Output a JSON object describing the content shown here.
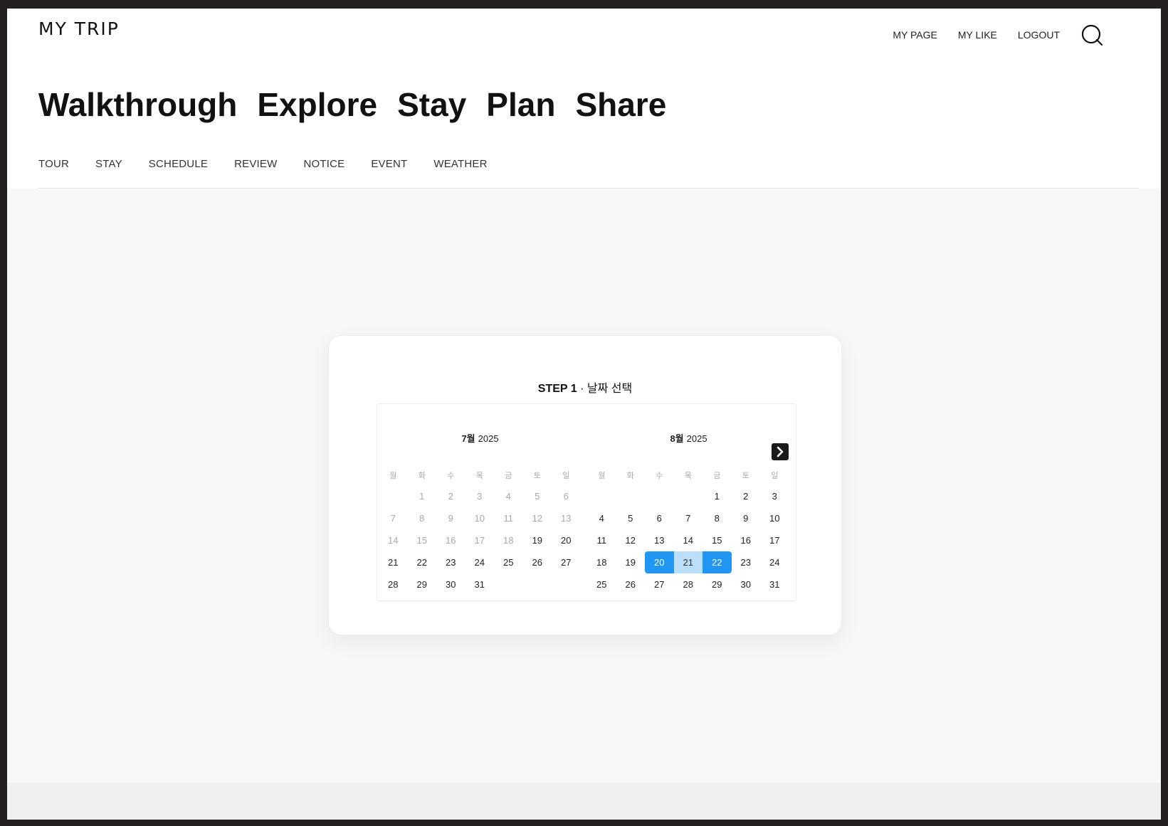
{
  "header": {
    "logo": "MY TRIP",
    "util_nav": [
      "MY PAGE",
      "MY LIKE",
      "LOGOUT"
    ],
    "search_icon": "search-icon"
  },
  "main_nav": [
    "Walkthrough",
    "Explore",
    "Stay",
    "Plan",
    "Share"
  ],
  "sub_nav": [
    "TOUR",
    "STAY",
    "SCHEDULE",
    "REVIEW",
    "NOTICE",
    "EVENT",
    "WEATHER"
  ],
  "step": {
    "label": "STEP 1",
    "separator": " · ",
    "title": "날짜 선택"
  },
  "calendar": {
    "next_icon": "chevron-right-icon",
    "weekdays": [
      "월",
      "화",
      "수",
      "목",
      "금",
      "토",
      "일"
    ],
    "selection": {
      "start": "2025-08-20",
      "end": "2025-08-22"
    },
    "colors": {
      "selected": "#2196f3",
      "in_range": "#bbdefb"
    },
    "months": [
      {
        "name": "7월",
        "year": "2025",
        "leading_blanks": 1,
        "days": 31,
        "disabled_through": 18
      },
      {
        "name": "8월",
        "year": "2025",
        "leading_blanks": 4,
        "days": 31,
        "disabled_through": 0,
        "selected_start": 20,
        "selected_end": 22
      }
    ]
  }
}
